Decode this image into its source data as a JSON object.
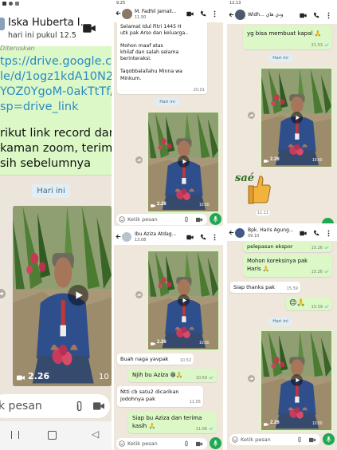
{
  "left": {
    "contact_name": "Iska Huberta I...",
    "link_lines": [
      "tps://drive.google.co",
      "le/d/1ogz1kdA10N2c",
      "YOZ0YgoM-0akTtTf/",
      "sp=drive_link"
    ],
    "truncated_top": "Diteruskan",
    "message_lines": [
      "rikut link record dari",
      "kaman zoom, terima",
      "sih sebelumnya"
    ],
    "partial_preview": "hari ini pukul 12.5",
    "date_separator": "Hari ini",
    "video_duration": "2.26",
    "video_time": "10",
    "input_placeholder": "k pesan"
  },
  "mid_top": {
    "status_time": "9.25",
    "contact_name": "M. Fadhil Jamali...",
    "contact_sub": "11.50",
    "message_lines": [
      "Selamat Idul Fitri 1445 H",
      "utk pak Arso dan keluarga..",
      "",
      "Mohon maaf atas",
      "khilaf dan salah selama",
      "berinteraksi.",
      "",
      "Taqobbalallahu Minna wa",
      "Minkum."
    ],
    "message_time": "20.01",
    "date_separator": "Hari ini",
    "video_duration": "2.26",
    "video_time": "10.50",
    "input_placeholder": "Ketik pesan"
  },
  "mid_bottom": {
    "contact_name": "Ibu Aziza Atdag...",
    "contact_sub": "13.08",
    "video_duration": "2.26",
    "video_time": "10.50",
    "messages": [
      {
        "text": "Buah naga yavpak",
        "time": "10.52",
        "dir": "in"
      },
      {
        "text": "Njih bu Aziza 😁🙏",
        "time": "10.59",
        "dir": "out"
      },
      {
        "text": "Ntti cb satu2 dicarikan jodohnya pak",
        "time": "11.05",
        "dir": "in"
      },
      {
        "text": "Siap bu Aziza dan terima kasih 🙏",
        "time": "11.06",
        "dir": "out"
      }
    ],
    "input_placeholder": "Ketik pesan"
  },
  "right_top": {
    "status_time": "12.13",
    "contact_name": "Widh... ودي هاي",
    "top_message": "yg bisa membuat kapal 🙏",
    "top_time": "21.53",
    "date_separator": "Hari ini",
    "video_duration": "2.26",
    "video_time": "10.50",
    "sticker_text": "saé",
    "sticker_time": "11.11"
  },
  "right_bottom": {
    "contact_name": "Bpk. Haris Agung...",
    "contact_sub": "09.10",
    "messages": [
      {
        "text": "pelepasan ekspor",
        "time": "15.26",
        "dir": "out"
      },
      {
        "text": "Mohon koreksinya pak Haris 🙏",
        "time": "15.26",
        "dir": "out"
      },
      {
        "text": "Siap thanks pak",
        "time": "15.59",
        "dir": "in"
      },
      {
        "text": "😊🙏",
        "time": "15.59",
        "dir": "out"
      }
    ],
    "date_separator": "Hari ini",
    "video_duration": "2.26",
    "video_time": "10.50",
    "input_placeholder": "Ketik pesan"
  },
  "colors": {
    "accent": "#1ea952",
    "wallpaper": "#efe7dc",
    "outgoing": "#dcf8c6",
    "separator": "#e1eef5"
  }
}
